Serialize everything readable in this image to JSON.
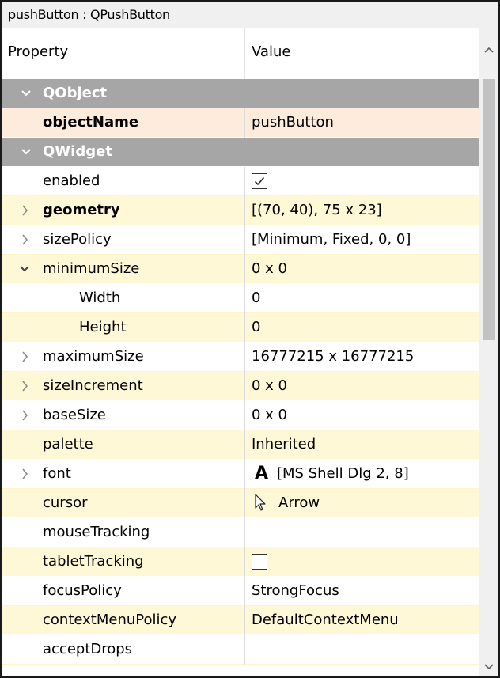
{
  "window": {
    "title": "pushButton : QPushButton"
  },
  "header": {
    "property": "Property",
    "value": "Value"
  },
  "rows": [
    {
      "name": "QObject",
      "value": "",
      "kind": "category",
      "expander": "expanded"
    },
    {
      "name": "objectName",
      "value": "pushButton",
      "kind": "selected",
      "bold": true
    },
    {
      "name": "QWidget",
      "value": "",
      "kind": "category",
      "expander": "expanded"
    },
    {
      "name": "enabled",
      "value": "",
      "kind": "normal",
      "checkbox": "checked"
    },
    {
      "name": "geometry",
      "value": "[(70, 40), 75 x 23]",
      "kind": "alt",
      "bold": true,
      "expander": "collapsed"
    },
    {
      "name": "sizePolicy",
      "value": "[Minimum, Fixed, 0, 0]",
      "kind": "normal",
      "expander": "collapsed"
    },
    {
      "name": "minimumSize",
      "value": "0 x 0",
      "kind": "alt",
      "expander": "expanded"
    },
    {
      "name": "Width",
      "value": "0",
      "kind": "normal",
      "indent": 1
    },
    {
      "name": "Height",
      "value": "0",
      "kind": "alt",
      "indent": 1
    },
    {
      "name": "maximumSize",
      "value": "16777215 x 16777215",
      "kind": "normal",
      "expander": "collapsed"
    },
    {
      "name": "sizeIncrement",
      "value": "0 x 0",
      "kind": "alt",
      "expander": "collapsed"
    },
    {
      "name": "baseSize",
      "value": "0 x 0",
      "kind": "normal",
      "expander": "collapsed"
    },
    {
      "name": "palette",
      "value": "Inherited",
      "kind": "alt"
    },
    {
      "name": "font",
      "value": "[MS Shell Dlg 2, 8]",
      "kind": "normal",
      "expander": "collapsed",
      "icon": "font-icon",
      "icon_glyph": "A"
    },
    {
      "name": "cursor",
      "value": "Arrow",
      "kind": "alt",
      "icon": "arrow-cursor-icon"
    },
    {
      "name": "mouseTracking",
      "value": "",
      "kind": "normal",
      "checkbox": "unchecked"
    },
    {
      "name": "tabletTracking",
      "value": "",
      "kind": "alt",
      "checkbox": "unchecked"
    },
    {
      "name": "focusPolicy",
      "value": "StrongFocus",
      "kind": "normal"
    },
    {
      "name": "contextMenuPolicy",
      "value": "DefaultContextMenu",
      "kind": "alt"
    },
    {
      "name": "acceptDrops",
      "value": "",
      "kind": "normal",
      "checkbox": "unchecked"
    }
  ],
  "scrollbar": {
    "up_icon": "chevron-up-icon",
    "down_icon": "chevron-down-icon"
  }
}
